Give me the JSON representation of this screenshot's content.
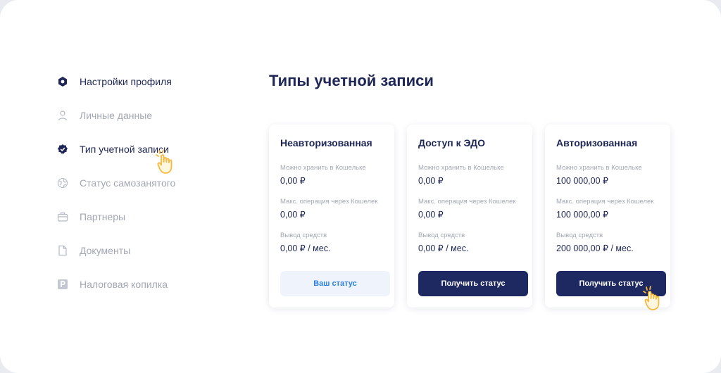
{
  "sidebar": {
    "items": [
      {
        "label": "Настройки профиля",
        "icon": "hexagon-settings-icon",
        "active": true
      },
      {
        "label": "Личные данные",
        "icon": "user-icon",
        "active": false
      },
      {
        "label": "Тип учетной записи",
        "icon": "verified-badge-icon",
        "active": true
      },
      {
        "label": "Статус самозанятого",
        "icon": "globe-icon",
        "active": false
      },
      {
        "label": "Партнеры",
        "icon": "briefcase-icon",
        "active": false
      },
      {
        "label": "Документы",
        "icon": "document-icon",
        "active": false
      },
      {
        "label": "Налоговая копилка",
        "icon": "parking-p-icon",
        "active": false
      }
    ]
  },
  "main": {
    "title": "Типы учетной записи",
    "cards": [
      {
        "title": "Неавторизованная",
        "fields": [
          {
            "label": "Можно хранить в Кошельке",
            "value": "0,00 ₽"
          },
          {
            "label": "Макс. операция через Кошелек",
            "value": "0,00 ₽"
          },
          {
            "label": "Вывод средств",
            "value": "0,00 ₽ / мес."
          }
        ],
        "button": "Ваш статус"
      },
      {
        "title": "Доступ к ЭДО",
        "fields": [
          {
            "label": "Можно хранить в Кошельке",
            "value": "0,00 ₽"
          },
          {
            "label": "Макс. операция через Кошелек",
            "value": "0,00 ₽"
          },
          {
            "label": "Вывод средств",
            "value": "0,00 ₽ / мес."
          }
        ],
        "button": "Получить статус"
      },
      {
        "title": "Авторизованная",
        "fields": [
          {
            "label": "Можно хранить в Кошельке",
            "value": "100 000,00 ₽"
          },
          {
            "label": "Макс. операция через Кошелек",
            "value": "100 000,00 ₽"
          },
          {
            "label": "Вывод средств",
            "value": "200 000,00 ₽ / мес."
          }
        ],
        "button": "Получить статус"
      }
    ]
  },
  "colors": {
    "primary": "#1d2656",
    "button_dark": "#1d2960",
    "muted": "#a3a7b4",
    "accent_blue": "#2e7fe0",
    "cursor_yellow": "#f6b93b"
  }
}
